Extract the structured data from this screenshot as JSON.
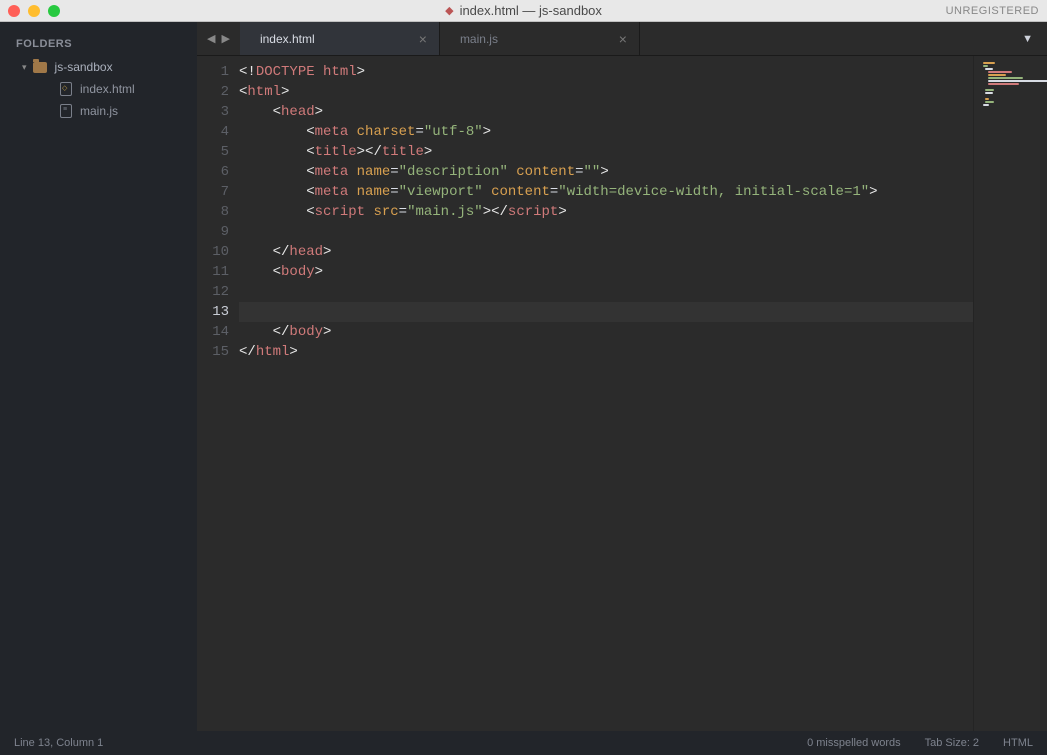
{
  "title": "index.html — js-sandbox",
  "unregistered": "UNREGISTERED",
  "sidebar": {
    "header": "FOLDERS",
    "project": "js-sandbox",
    "files": [
      {
        "name": "index.html",
        "type": "html"
      },
      {
        "name": "main.js",
        "type": "js"
      }
    ]
  },
  "tabs": [
    {
      "label": "index.html",
      "active": true
    },
    {
      "label": "main.js",
      "active": false
    }
  ],
  "editor": {
    "active_line": 13,
    "lines": [
      {
        "n": 1,
        "ind": 0,
        "tokens": [
          [
            "<!",
            "angle"
          ],
          [
            "DOCTYPE html",
            "tag"
          ],
          [
            ">",
            "angle"
          ]
        ]
      },
      {
        "n": 2,
        "ind": 0,
        "tokens": [
          [
            "<",
            "angle"
          ],
          [
            "html",
            "tag"
          ],
          [
            ">",
            "angle"
          ]
        ]
      },
      {
        "n": 3,
        "ind": 4,
        "tokens": [
          [
            "<",
            "angle"
          ],
          [
            "head",
            "tag"
          ],
          [
            ">",
            "angle"
          ]
        ]
      },
      {
        "n": 4,
        "ind": 8,
        "tokens": [
          [
            "<",
            "angle"
          ],
          [
            "meta",
            "tag"
          ],
          [
            " ",
            "plain"
          ],
          [
            "charset",
            "attr"
          ],
          [
            "=",
            "eq"
          ],
          [
            "\"utf-8\"",
            "str"
          ],
          [
            ">",
            "angle"
          ]
        ]
      },
      {
        "n": 5,
        "ind": 8,
        "tokens": [
          [
            "<",
            "angle"
          ],
          [
            "title",
            "tag"
          ],
          [
            "></",
            "angle"
          ],
          [
            "title",
            "tag"
          ],
          [
            ">",
            "angle"
          ]
        ]
      },
      {
        "n": 6,
        "ind": 8,
        "tokens": [
          [
            "<",
            "angle"
          ],
          [
            "meta",
            "tag"
          ],
          [
            " ",
            "plain"
          ],
          [
            "name",
            "attr"
          ],
          [
            "=",
            "eq"
          ],
          [
            "\"description\"",
            "str"
          ],
          [
            " ",
            "plain"
          ],
          [
            "content",
            "attr"
          ],
          [
            "=",
            "eq"
          ],
          [
            "\"\"",
            "str"
          ],
          [
            ">",
            "angle"
          ]
        ]
      },
      {
        "n": 7,
        "ind": 8,
        "tokens": [
          [
            "<",
            "angle"
          ],
          [
            "meta",
            "tag"
          ],
          [
            " ",
            "plain"
          ],
          [
            "name",
            "attr"
          ],
          [
            "=",
            "eq"
          ],
          [
            "\"viewport\"",
            "str"
          ],
          [
            " ",
            "plain"
          ],
          [
            "content",
            "attr"
          ],
          [
            "=",
            "eq"
          ],
          [
            "\"width=device-width, initial-scale=1\"",
            "str"
          ],
          [
            ">",
            "angle"
          ]
        ]
      },
      {
        "n": 8,
        "ind": 8,
        "tokens": [
          [
            "<",
            "angle"
          ],
          [
            "script",
            "tag"
          ],
          [
            " ",
            "plain"
          ],
          [
            "src",
            "attr"
          ],
          [
            "=",
            "eq"
          ],
          [
            "\"main.js\"",
            "str"
          ],
          [
            "></",
            "angle"
          ],
          [
            "script",
            "tag"
          ],
          [
            ">",
            "angle"
          ]
        ]
      },
      {
        "n": 9,
        "ind": 0,
        "tokens": []
      },
      {
        "n": 10,
        "ind": 4,
        "tokens": [
          [
            "</",
            "angle"
          ],
          [
            "head",
            "tag"
          ],
          [
            ">",
            "angle"
          ]
        ]
      },
      {
        "n": 11,
        "ind": 4,
        "tokens": [
          [
            "<",
            "angle"
          ],
          [
            "body",
            "tag"
          ],
          [
            ">",
            "angle"
          ]
        ]
      },
      {
        "n": 12,
        "ind": 0,
        "tokens": []
      },
      {
        "n": 13,
        "ind": 4,
        "tokens": []
      },
      {
        "n": 14,
        "ind": 4,
        "tokens": [
          [
            "</",
            "angle"
          ],
          [
            "body",
            "tag"
          ],
          [
            ">",
            "angle"
          ]
        ]
      },
      {
        "n": 15,
        "ind": 0,
        "tokens": [
          [
            "</",
            "angle"
          ],
          [
            "html",
            "tag"
          ],
          [
            ">",
            "angle"
          ]
        ]
      }
    ]
  },
  "statusbar": {
    "position": "Line 13, Column 1",
    "spell": "0 misspelled words",
    "tabsize": "Tab Size: 2",
    "syntax": "HTML"
  }
}
